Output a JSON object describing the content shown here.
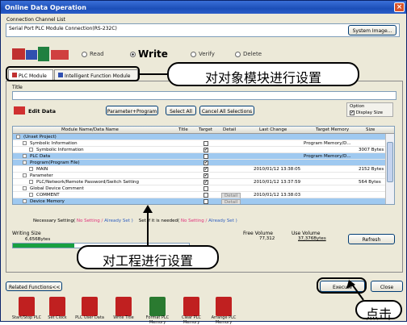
{
  "window": {
    "title": "Online Data Operation"
  },
  "connection": {
    "group_label": "Connection Channel List",
    "value": "Serial Port  PLC Module Connection(RS-232C)",
    "system_image_label": "System Image..."
  },
  "mode": {
    "read": "Read",
    "write": "Write",
    "verify": "Verify",
    "delete": "Delete",
    "selected": "Write"
  },
  "tabs": [
    {
      "label": "PLC Module"
    },
    {
      "label": "Intelligent Function Module"
    }
  ],
  "title_field": {
    "label": "Title"
  },
  "toolbar": {
    "edit_data": "Edit Data",
    "param_program": "Parameter+Program",
    "select_all": "Select All",
    "cancel_all": "Cancel All Selections",
    "option": "Option",
    "display_size": "Display Size"
  },
  "grid": {
    "columns": [
      "Module Name/Data Name",
      "Title",
      "Target",
      "Detail",
      "Last Change",
      "Target Memory",
      "Size"
    ],
    "rows": [
      {
        "name": "(Unset Project)",
        "title": "",
        "target": "",
        "detail": "",
        "last": "",
        "mem": "",
        "size": "",
        "level": 0,
        "hl": true
      },
      {
        "name": "Symbolic Information",
        "title": "",
        "target": "",
        "detail": "",
        "last": "",
        "mem": "Program Memory/D...",
        "size": "",
        "level": 1,
        "hl": false
      },
      {
        "name": "Symbolic Information",
        "title": "",
        "target": "✔",
        "detail": "",
        "last": "",
        "mem": "",
        "size": "3007 Bytes",
        "level": 2,
        "hl": false
      },
      {
        "name": "PLC Data",
        "title": "",
        "target": "",
        "detail": "",
        "last": "",
        "mem": "Program Memory/D...",
        "size": "",
        "level": 1,
        "hl": true
      },
      {
        "name": "Program(Program File)",
        "title": "",
        "target": "✔",
        "detail": "",
        "last": "",
        "mem": "",
        "size": "",
        "level": 1,
        "hl": true
      },
      {
        "name": "MAIN",
        "title": "",
        "target": "✔",
        "detail": "",
        "last": "2010/01/12 13:38:05",
        "mem": "",
        "size": "2152 Bytes",
        "level": 2,
        "hl": false
      },
      {
        "name": "Parameter",
        "title": "",
        "target": "✔",
        "detail": "",
        "last": "",
        "mem": "",
        "size": "",
        "level": 1,
        "hl": false
      },
      {
        "name": "PLC/Network/Remote Password/Switch Setting",
        "title": "",
        "target": "✔",
        "detail": "",
        "last": "2010/01/12 13:37:59",
        "mem": "",
        "size": "564 Bytes",
        "level": 2,
        "hl": false
      },
      {
        "name": "Global Device Comment",
        "title": "",
        "target": "",
        "detail": "",
        "last": "",
        "mem": "",
        "size": "",
        "level": 1,
        "hl": false
      },
      {
        "name": "COMMENT",
        "title": "",
        "target": "",
        "detail": "Detail",
        "last": "2010/01/12 13:38:03",
        "mem": "",
        "size": "",
        "level": 2,
        "hl": false
      },
      {
        "name": "Device Memory",
        "title": "",
        "target": "",
        "detail": "Detail",
        "last": "",
        "mem": "",
        "size": "",
        "level": 1,
        "hl": true
      }
    ]
  },
  "legend": {
    "necessary": "Necessary Setting(",
    "no_setting": " No Setting / ",
    "already_set": " Already Set  )",
    "if_needed": "Set if it is needed(",
    "no_setting2": " No Setting / ",
    "already_set2": " Already Set  )"
  },
  "writing_size": {
    "label": "Writing Size",
    "value": "6,656Bytes",
    "fill": 0.35
  },
  "free_volume": {
    "label": "Free Volume",
    "value": "77,312"
  },
  "use_volume": {
    "label": "Use Volume",
    "value": "37,376Bytes"
  },
  "refresh_label": "Refresh",
  "related_label": "Related Functions<<",
  "execute_label": "Execute",
  "close_label": "Close",
  "functions": [
    {
      "label": "Start/Stop PLC",
      "icon": "start-stop-icon",
      "color": "#c02020"
    },
    {
      "label": "Set Clock",
      "icon": "clock-icon",
      "color": "#c02020"
    },
    {
      "label": "PLC User Data",
      "icon": "user-data-icon",
      "color": "#c02020"
    },
    {
      "label": "Write Title",
      "icon": "write-title-icon",
      "color": "#c02020"
    },
    {
      "label": "Format PLC Memory",
      "icon": "format-icon",
      "color": "#2a7a30"
    },
    {
      "label": "Clear PLC Memory",
      "icon": "clear-icon",
      "color": "#c02020"
    },
    {
      "label": "Arrange PLC Memory",
      "icon": "arrange-icon",
      "color": "#c02020"
    }
  ],
  "annotations": {
    "module_setting": "对对象模块进行设置",
    "project_setting": "对工程进行设置",
    "click": "点击"
  },
  "colors": {
    "title_bar": "#1c4fb8",
    "highlight_row": "#9fc9f0",
    "progress": "#18a040",
    "no_setting": "#e0307a",
    "already_set": "#3060c0"
  }
}
